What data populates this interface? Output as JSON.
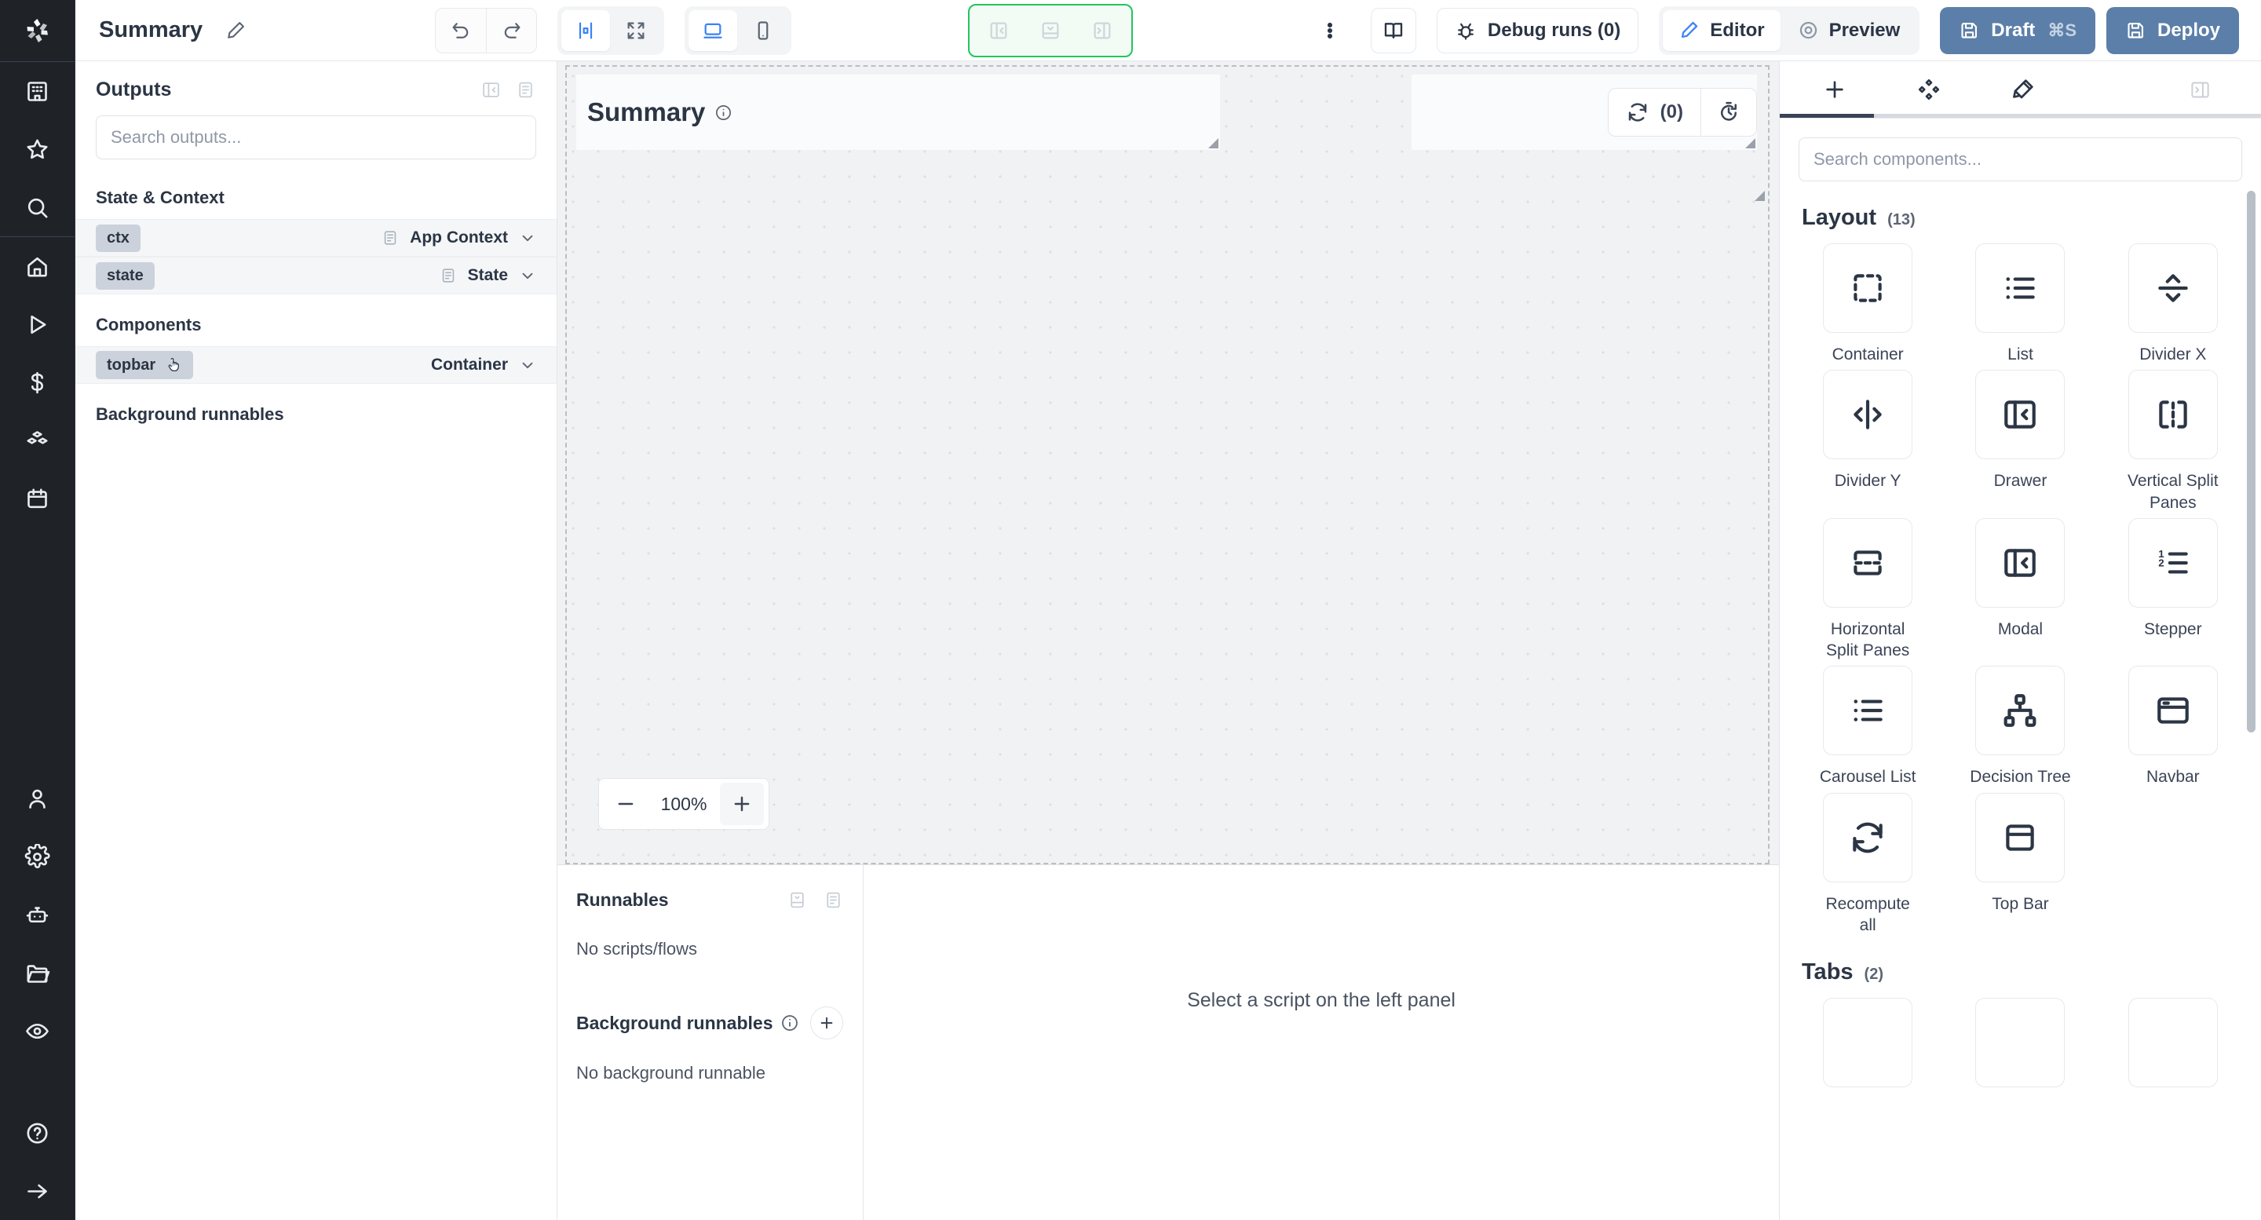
{
  "header": {
    "app_title": "Summary",
    "edit_icon": "pencil-icon",
    "history": {
      "undo": "undo-icon",
      "redo": "redo-icon"
    },
    "align_group": [
      {
        "icon": "center-align-icon",
        "selected": true
      },
      {
        "icon": "expand-icon",
        "selected": false
      }
    ],
    "device_group": [
      {
        "icon": "desktop-icon",
        "selected": true
      },
      {
        "icon": "mobile-icon",
        "selected": false
      }
    ],
    "panel_group": [
      {
        "icon": "panel-left-icon"
      },
      {
        "icon": "panel-bottom-icon"
      },
      {
        "icon": "panel-right-icon"
      }
    ],
    "more_icon": "vertical-dots-icon",
    "docs_icon": "book-icon",
    "debug_runs_label": "Debug runs (0)",
    "debug_icon": "bug-icon",
    "editor_label": "Editor",
    "editor_icon": "pencil-icon",
    "preview_label": "Preview",
    "preview_icon": "eye-target-icon",
    "draft_label": "Draft",
    "draft_shortcut": "⌘S",
    "draft_icon": "save-icon",
    "deploy_label": "Deploy",
    "deploy_icon": "save-icon",
    "accent_blue": "#3b82f6",
    "button_blue": "#5b7fa8",
    "selection_green": "#22c55e"
  },
  "rail": {
    "logo": "windmill-logo",
    "items": [
      {
        "name": "workspace-icon"
      },
      {
        "name": "star-icon"
      },
      {
        "name": "search-icon"
      },
      {
        "name": "home-icon"
      },
      {
        "name": "runs-icon"
      },
      {
        "name": "dollar-icon"
      },
      {
        "name": "resources-icon"
      },
      {
        "name": "schedules-icon"
      }
    ],
    "bottom_items": [
      {
        "name": "user-icon"
      },
      {
        "name": "settings-icon"
      },
      {
        "name": "workers-icon"
      },
      {
        "name": "folder-icon"
      },
      {
        "name": "eye-icon"
      },
      {
        "name": "help-icon"
      },
      {
        "name": "collapse-arrow-icon"
      }
    ]
  },
  "outputs": {
    "title": "Outputs",
    "header_icons": [
      "panel-collapse-icon",
      "list-icon"
    ],
    "search_placeholder": "Search outputs...",
    "search_value": "",
    "sections": [
      {
        "label": "State & Context",
        "rows": [
          {
            "key": "ctx",
            "type": "App Context",
            "has_doc_icon": true
          },
          {
            "key": "state",
            "type": "State",
            "has_doc_icon": true
          }
        ]
      },
      {
        "label": "Components",
        "rows": [
          {
            "key": "topbar",
            "type": "Container",
            "has_doc_icon": false,
            "hovered": true
          }
        ]
      }
    ],
    "background_runnables_label": "Background runnables"
  },
  "canvas": {
    "topbar_component": {
      "title": "Summary",
      "info_icon": "info-icon"
    },
    "recompute": {
      "refresh_icon": "refresh-icon",
      "count_label": "(0)",
      "history_icon": "timer-reset-icon"
    },
    "zoom": {
      "minus": "−",
      "value": "100%",
      "plus": "+"
    }
  },
  "runnables": {
    "title": "Runnables",
    "header_icons": [
      "collapse-icon",
      "list-icon"
    ],
    "empty_label": "No scripts/flows",
    "background_title": "Background runnables",
    "background_info_icon": "info-icon",
    "background_add_icon": "plus-icon",
    "background_empty_label": "No background runnable"
  },
  "script_pane": {
    "empty_label": "Select a script on the left panel"
  },
  "components_panel": {
    "tabs": [
      {
        "icon": "plus-icon",
        "active": true
      },
      {
        "icon": "components-icon",
        "active": false
      },
      {
        "icon": "brush-icon",
        "active": false
      }
    ],
    "collapse_icon": "panel-right-icon",
    "search_placeholder": "Search components...",
    "search_value": "",
    "groups": [
      {
        "name": "Layout",
        "count": "(13)",
        "items": [
          {
            "label": "Container",
            "icon": "dashed-square-icon"
          },
          {
            "label": "List",
            "icon": "list-icon"
          },
          {
            "label": "Divider X",
            "icon": "divider-x-icon"
          },
          {
            "label": "Divider Y",
            "icon": "divider-y-icon"
          },
          {
            "label": "Drawer",
            "icon": "drawer-icon"
          },
          {
            "label": "Vertical Split Panes",
            "icon": "vertical-split-icon"
          },
          {
            "label": "Horizontal Split Panes",
            "icon": "horizontal-split-icon"
          },
          {
            "label": "Modal",
            "icon": "modal-icon"
          },
          {
            "label": "Stepper",
            "icon": "ordered-list-icon"
          },
          {
            "label": "Carousel List",
            "icon": "list-icon"
          },
          {
            "label": "Decision Tree",
            "icon": "tree-icon"
          },
          {
            "label": "Navbar",
            "icon": "navbar-icon"
          },
          {
            "label": "Recompute all",
            "icon": "refresh-icon"
          },
          {
            "label": "Top Bar",
            "icon": "topbar-icon"
          }
        ]
      },
      {
        "name": "Tabs",
        "count": "(2)",
        "items": []
      }
    ]
  }
}
